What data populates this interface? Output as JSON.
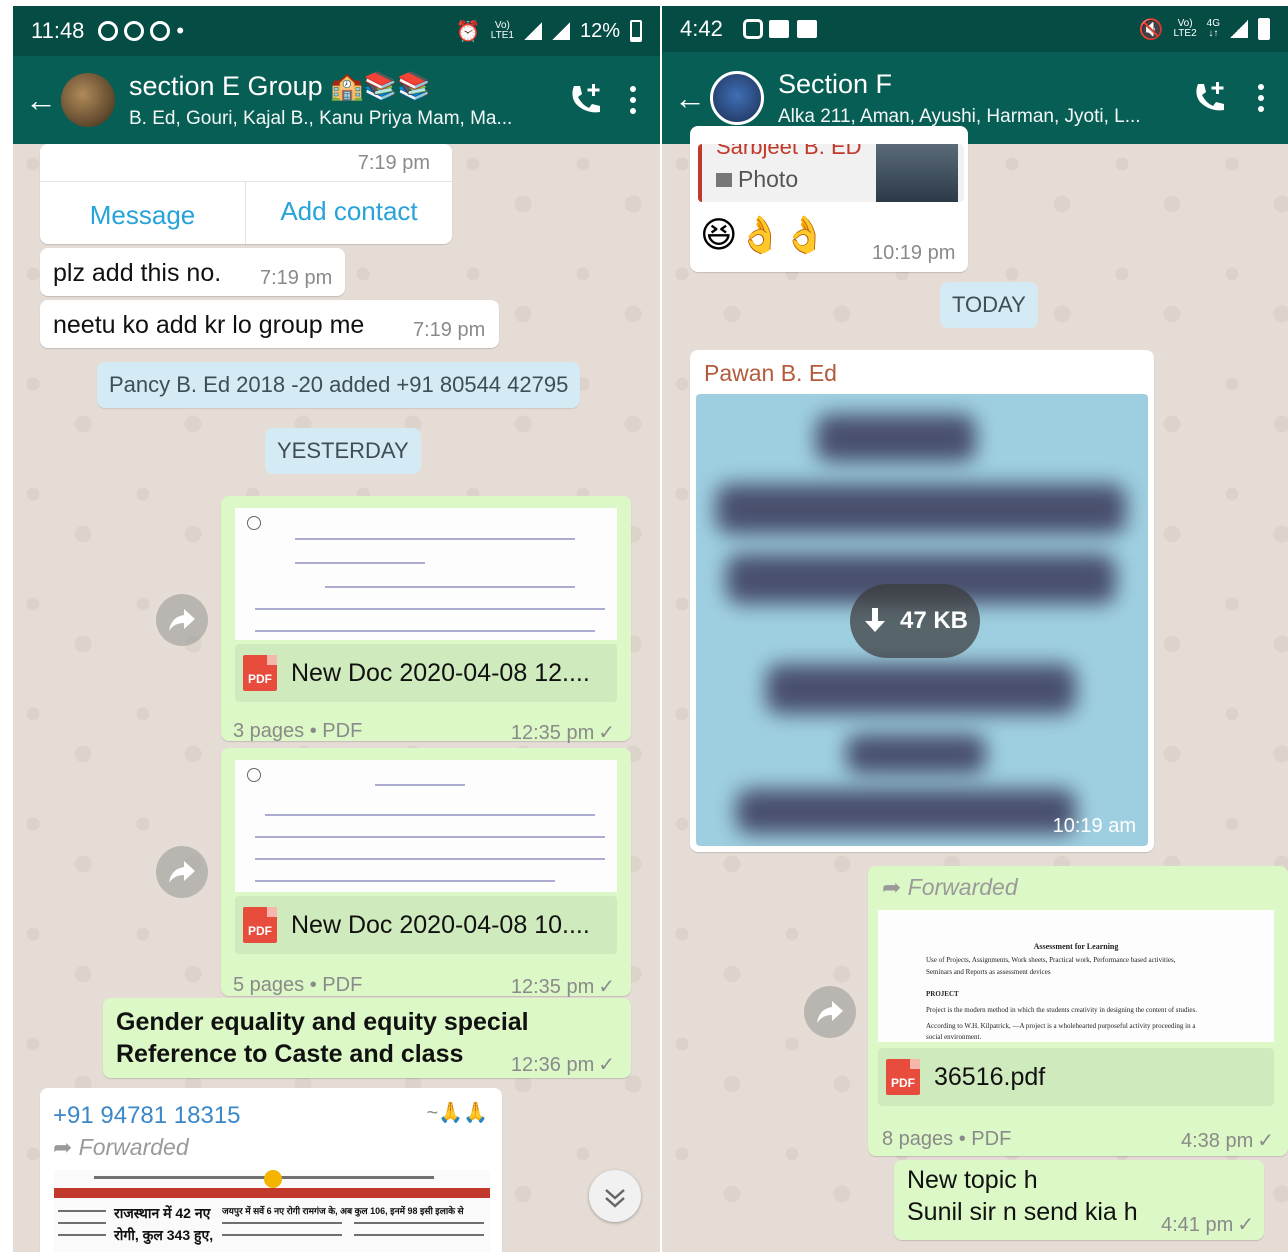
{
  "left": {
    "status": {
      "time": "11:48",
      "battery": "12%"
    },
    "header": {
      "title": "section E Group",
      "subtitle": "B. Ed, Gouri, Kajal B., Kanu Priya Mam, Ma..."
    },
    "contact_card": {
      "time": "7:19 pm",
      "message_btn": "Message",
      "add_btn": "Add contact"
    },
    "msg1": {
      "text": "plz add this no.",
      "time": "7:19 pm"
    },
    "msg2": {
      "text": "neetu ko add kr lo group me",
      "time": "7:19 pm"
    },
    "system_msg": "Pancy B. Ed 2018 -20 added +91 80544 42795",
    "date_chip": "YESTERDAY",
    "doc1": {
      "name": "New Doc 2020-04-08 12....",
      "info": "3 pages • PDF",
      "time": "12:35 pm",
      "badge": "PDF"
    },
    "doc2": {
      "name": "New Doc 2020-04-08 10....",
      "info": "5 pages • PDF",
      "time": "12:35 pm",
      "badge": "PDF"
    },
    "msg3": {
      "line1": "Gender equality and equity special",
      "line2": "Reference to Caste and class",
      "time": "12:36 pm"
    },
    "incoming": {
      "sender": "+91 94781 18315",
      "name_tag": "~🙏🙏",
      "forwarded": "Forwarded",
      "news_headline1": "राजस्थान में 42 नए",
      "news_headline2": "रोगी, कुल 343 हुए,",
      "news_headline3": "जयपुर में सर्वे 6 नए रोगी रामगंज के, अब कुल 106, इनमें 98 इसी इलाके से"
    }
  },
  "right": {
    "status": {
      "time": "4:42"
    },
    "header": {
      "title": "Section F",
      "subtitle": "Alka 211, Aman, Ayushi, Harman, Jyoti, L..."
    },
    "quoted": {
      "author": "Sarbjeet B. ED",
      "type": "Photo",
      "time": "10:19 pm"
    },
    "emojis": "😆👌👌",
    "date_chip": "TODAY",
    "image_msg": {
      "sender": "Pawan B. Ed",
      "size": "47 KB",
      "time": "10:19 am"
    },
    "doc": {
      "forwarded": "Forwarded",
      "title": "Assessment for Learning",
      "line1": "Use of Projects, Assignments, Work sheets, Practical work, Performance based activities,",
      "line2": "Seminars and Reports as assessment devices",
      "heading": "PROJECT",
      "line3": "Project is the modern method in which the students creativity in designing the content of studies.",
      "line4": "According to W.H. Kilpatrick, —A project is a wholehearted purposeful activity proceeding in a",
      "line5": "social environment.",
      "name": "36516.pdf",
      "info": "8 pages • PDF",
      "time": "4:38 pm",
      "badge": "PDF"
    },
    "msg": {
      "line1": "New topic h",
      "line2": "Sunil sir n send kia h",
      "time": "4:41 pm"
    }
  },
  "colors": {
    "status_bar": "#054d44",
    "app_bar": "#075e54",
    "outgoing": "#dcf8c6",
    "link": "#27a3da"
  }
}
